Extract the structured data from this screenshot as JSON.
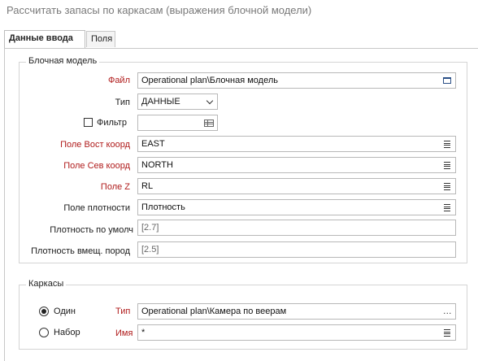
{
  "window": {
    "title": "Рассчитать запасы по каркасам (выражения блочной модели)"
  },
  "tabs": [
    {
      "label": "Данные ввода",
      "active": true
    },
    {
      "label": "Поля",
      "active": false
    }
  ],
  "block_model": {
    "group_label": "Блочная модель",
    "file": {
      "label": "Файл",
      "value": "Operational plan\\Блочная модель",
      "icon": "window-icon"
    },
    "type": {
      "label": "Тип",
      "value": "ДАННЫЕ"
    },
    "filter": {
      "label": "Фильтр",
      "checked": false,
      "value": "",
      "icon": "filter-grid-icon"
    },
    "east": {
      "label": "Поле Вост коорд",
      "value": "EAST"
    },
    "north": {
      "label": "Поле Сев коорд",
      "value": "NORTH"
    },
    "z": {
      "label": "Поле Z",
      "value": "RL"
    },
    "density_field": {
      "label": "Поле плотности",
      "value": "Плотность"
    },
    "default_density": {
      "label": "Плотность по умолч",
      "value": "[2.7]"
    },
    "host_density": {
      "label": "Плотность вмещ. пород",
      "value": "[2.5]"
    }
  },
  "wireframes": {
    "group_label": "Каркасы",
    "single": {
      "label": "Один",
      "selected": true
    },
    "set": {
      "label": "Набор",
      "selected": false
    },
    "type": {
      "label": "Тип",
      "value": "Operational plan\\Камера по веерам",
      "icon": "ellipsis-icon"
    },
    "name": {
      "label": "Имя",
      "value": "*"
    }
  },
  "colors": {
    "required_label": "#b01c1c",
    "title": "#7a7a7a"
  }
}
